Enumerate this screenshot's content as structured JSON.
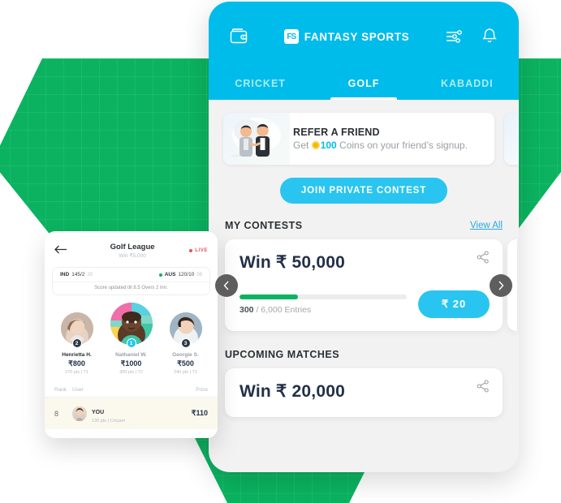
{
  "header": {
    "wallet_icon": "wallet-icon",
    "brand_mark": "FS",
    "brand_name": "FANTASY SPORTS",
    "filter_icon": "sliders-icon",
    "bell_icon": "bell-icon"
  },
  "tabs": [
    {
      "label": "CRICKET",
      "active": false
    },
    {
      "label": "GOLF",
      "active": true
    },
    {
      "label": "KABADDI",
      "active": false
    }
  ],
  "banner": {
    "title": "REFER A FRIEND",
    "sub_prefix": "Get ",
    "coin_icon": "coin-icon",
    "coins": "100",
    "sub_suffix": " Coins on your friend’s signup."
  },
  "cta": {
    "label": "JOIN PRIVATE CONTEST"
  },
  "my_contests": {
    "section_title": "MY CONTESTS",
    "view_all": "View All",
    "prev_icon": "chevron-left-icon",
    "next_icon": "chevron-right-icon",
    "card": {
      "win_label": "Win ₹ 50,000",
      "share_icon": "share-icon",
      "progress_percent": 35,
      "entries_filled": "300",
      "entries_total": " / 6,000 Entries",
      "fee_label": "₹  20"
    }
  },
  "upcoming": {
    "section_title": "UPCOMING MATCHES",
    "card": {
      "win_label": "Win ₹ 20,000",
      "share_icon": "share-icon"
    }
  },
  "live_card": {
    "back_icon": "back-arrow-icon",
    "title": "Golf League",
    "subtitle": "Win ₹5,000",
    "live_label": "LIVE",
    "scores": [
      {
        "team": "IND",
        "score": "145/2",
        "overs": "20"
      },
      {
        "team": "AUS",
        "score": "120/10",
        "overs": "08"
      }
    ],
    "score_note": "Score updated till 8.5 Overs 2 inn.",
    "players": [
      {
        "name": "Henrietta H.",
        "amount": "₹800",
        "meta": "270 pts  |  T1",
        "rank": "2",
        "badge_color": "#2b3a4a",
        "size": 40,
        "dim": true
      },
      {
        "name": "Nathaniel W.",
        "amount": "₹1000",
        "meta": "300 pts  |  T2",
        "rank": "1",
        "badge_color": "#29C5F0",
        "size": 52,
        "dim": false
      },
      {
        "name": "Georgie S.",
        "amount": "₹500",
        "meta": "240 pts  |  T1",
        "rank": "3",
        "badge_color": "#2b3a4a",
        "size": 40,
        "dim": true
      }
    ],
    "table_headers": {
      "rank": "Rank",
      "user": "User",
      "prize": "Prize"
    },
    "row": {
      "rank": "8",
      "user": "YOU",
      "meta": "130 pts  |  Cricjam",
      "prize": "₹110"
    }
  },
  "colors": {
    "brand_blue": "#00BCEB",
    "accent_blue": "#29C5F0",
    "green": "#0BB360",
    "dark_navy": "#223049",
    "live_red": "#E8505B"
  }
}
